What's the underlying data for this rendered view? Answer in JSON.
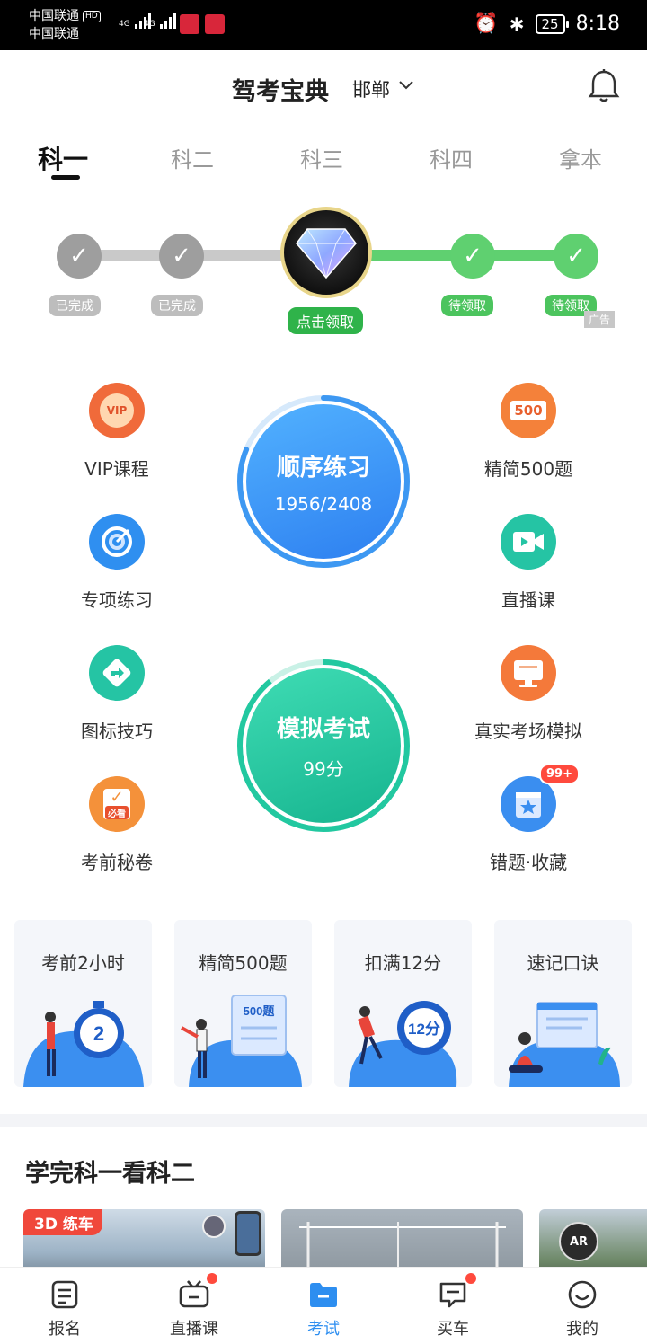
{
  "status_bar": {
    "carrier1": "中国联通",
    "hd": "HD",
    "carrier2": "中国联通",
    "net1": "4G",
    "net2": "4G",
    "battery": "25",
    "time": "8:18"
  },
  "header": {
    "title": "驾考宝典",
    "city": "邯郸"
  },
  "tabs": [
    {
      "label": "科一",
      "active": true
    },
    {
      "label": "科二"
    },
    {
      "label": "科三"
    },
    {
      "label": "科四"
    },
    {
      "label": "拿本"
    }
  ],
  "progress": {
    "steps": [
      "已完成",
      "已完成",
      "点击领取",
      "待领取",
      "待领取"
    ],
    "ad_label": "广告"
  },
  "features_left": [
    {
      "label": "VIP课程",
      "icon": "vip-medal-icon",
      "color": "#f06a3a"
    },
    {
      "label": "专项练习",
      "icon": "target-icon",
      "color": "#2f8ff0"
    },
    {
      "label": "图标技巧",
      "icon": "road-sign-icon",
      "color": "#25c4a4"
    },
    {
      "label": "考前秘卷",
      "icon": "exam-paper-icon",
      "color": "#f4913a",
      "sub": "必看"
    }
  ],
  "features_right": [
    {
      "label": "精简500题",
      "icon": "500-board-icon",
      "color": "#f4813a",
      "text": "500"
    },
    {
      "label": "直播课",
      "icon": "video-camera-icon",
      "color": "#25c4a4"
    },
    {
      "label": "真实考场模拟",
      "icon": "monitor-icon",
      "color": "#f4793a"
    },
    {
      "label": "错题·收藏",
      "icon": "star-box-icon",
      "color": "#3a8ef0",
      "badge": "99+"
    }
  ],
  "practice": {
    "title": "顺序练习",
    "progress_text": "1956/2408",
    "done": 1956,
    "total": 2408
  },
  "exam": {
    "title": "模拟考试",
    "score": "99分"
  },
  "cards": [
    {
      "title": "考前2小时",
      "art": "2"
    },
    {
      "title": "精简500题",
      "art": "500题"
    },
    {
      "title": "扣满12分",
      "art": "12分"
    },
    {
      "title": "速记口诀"
    }
  ],
  "section": {
    "title": "学完科一看科二",
    "tag": "3D 练车",
    "ar": "AR"
  },
  "bottom_nav": [
    {
      "label": "报名",
      "icon": "document-icon"
    },
    {
      "label": "直播课",
      "icon": "tv-icon",
      "dot": true
    },
    {
      "label": "考试",
      "icon": "folder-icon",
      "active": true
    },
    {
      "label": "买车",
      "icon": "chat-car-icon",
      "dot": true
    },
    {
      "label": "我的",
      "icon": "smile-icon"
    }
  ],
  "colors": {
    "accent": "#2d8ef0",
    "green": "#4cc45e",
    "red": "#ff4a3d"
  }
}
